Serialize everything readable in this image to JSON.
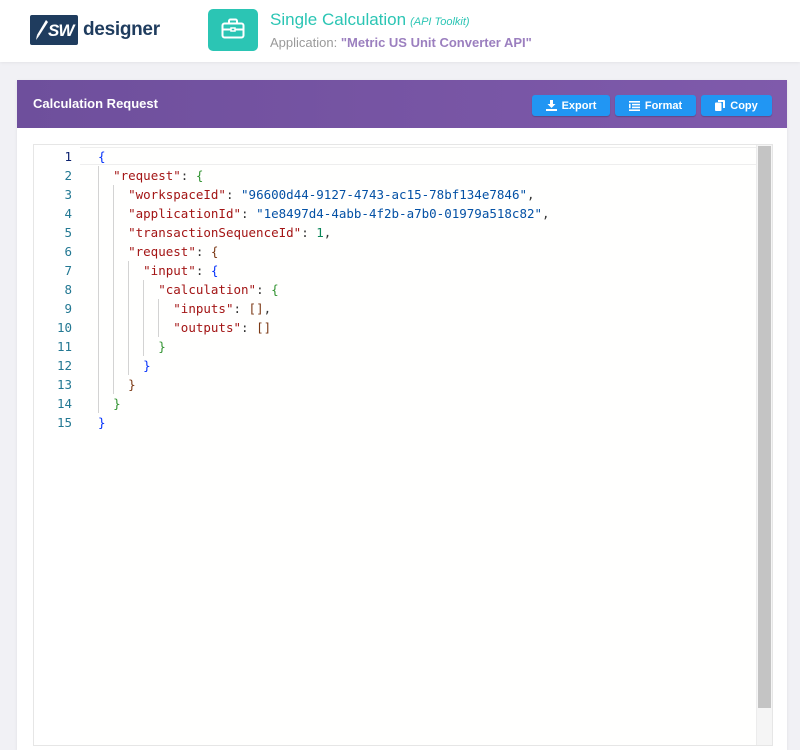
{
  "header": {
    "logo_sw": "SW",
    "logo_text": "designer",
    "app_title": "Single Calculation",
    "app_tool": "(API Toolkit)",
    "app_label": "Application:",
    "app_name": "\"Metric US Unit Converter API\"",
    "app_icon": "briefcase-icon"
  },
  "panel": {
    "title": "Calculation Request",
    "buttons": {
      "export": "Export",
      "format": "Format",
      "copy": "Copy"
    },
    "icons": {
      "export": "download-icon",
      "format": "align-left-icon",
      "copy": "copy-icon"
    }
  },
  "editor": {
    "active_line": 1,
    "lines": [
      {
        "n": "1"
      },
      {
        "n": "2"
      },
      {
        "n": "3"
      },
      {
        "n": "4"
      },
      {
        "n": "5"
      },
      {
        "n": "6"
      },
      {
        "n": "7"
      },
      {
        "n": "8"
      },
      {
        "n": "9"
      },
      {
        "n": "10"
      },
      {
        "n": "11"
      },
      {
        "n": "12"
      },
      {
        "n": "13"
      },
      {
        "n": "14"
      },
      {
        "n": "15"
      }
    ],
    "tokens": {
      "k_request": "\"request\"",
      "k_workspaceId": "\"workspaceId\"",
      "v_workspaceId": "\"96600d44-9127-4743-ac15-78bf134e7846\"",
      "k_applicationId": "\"applicationId\"",
      "v_applicationId": "\"1e8497d4-4abb-4f2b-a7b0-01979a518c82\"",
      "k_transactionSequenceId": "\"transactionSequenceId\"",
      "v_transactionSequenceId": "1",
      "k_input": "\"input\"",
      "k_calculation": "\"calculation\"",
      "k_inputs": "\"inputs\"",
      "k_outputs": "\"outputs\""
    }
  },
  "colors": {
    "accent_teal": "#2bc5b4",
    "header_purple": "#6e4f9c",
    "button_blue": "#2196f3",
    "app_name_purple": "#9b7fbf"
  }
}
